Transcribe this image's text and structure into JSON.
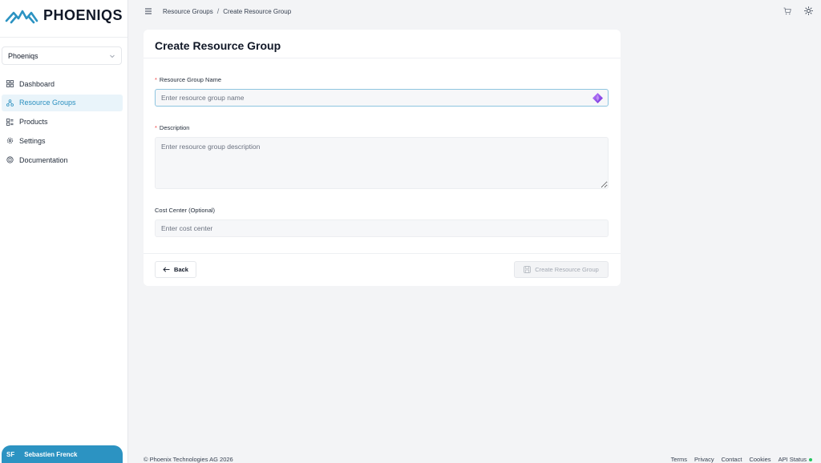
{
  "brand": {
    "name": "PHOENIQS",
    "accent": "#2c93c2"
  },
  "sidebar": {
    "org_select": {
      "value": "Phoeniqs",
      "icon": "chevron-down-icon"
    },
    "items": [
      {
        "label": "Dashboard",
        "icon": "dashboard-icon",
        "active": false
      },
      {
        "label": "Resource Groups",
        "icon": "resource-groups-icon",
        "active": true
      },
      {
        "label": "Products",
        "icon": "products-icon",
        "active": false
      },
      {
        "label": "Settings",
        "icon": "gear-icon",
        "active": false
      },
      {
        "label": "Documentation",
        "icon": "documentation-icon",
        "active": false
      }
    ],
    "user": {
      "initials": "SF",
      "name": "Sebastien Frenck"
    }
  },
  "header": {
    "breadcrumb": [
      "Resource Groups",
      "Create Resource Group"
    ],
    "separator": "/"
  },
  "form": {
    "title": "Create Resource Group",
    "required_marker": "*",
    "name": {
      "label": "Resource Group Name",
      "placeholder": "Enter resource group name",
      "value": ""
    },
    "description": {
      "label": "Description",
      "placeholder": "Enter resource group description",
      "value": ""
    },
    "cost_center": {
      "label": "Cost Center (Optional)",
      "placeholder": "Enter cost center",
      "value": ""
    },
    "back_label": "Back",
    "submit_label": "Create Resource Group"
  },
  "footer": {
    "copyright": "© Phoenix Technologies AG 2026",
    "links": [
      "Terms",
      "Privacy",
      "Contact",
      "Cookies",
      "API Status"
    ],
    "status_color": "#22c55e"
  }
}
